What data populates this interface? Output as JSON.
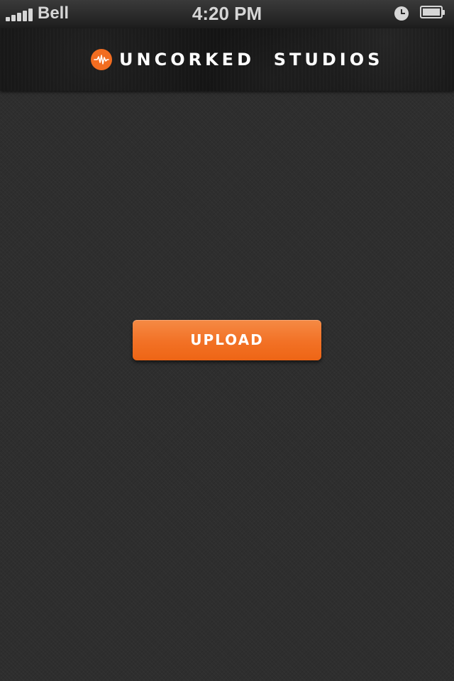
{
  "status_bar": {
    "carrier": "Bell",
    "time": "4:20 PM",
    "signal_bars": 5,
    "icons": [
      "signal-icon",
      "alarm-icon",
      "battery-icon"
    ]
  },
  "header": {
    "brand_name": "UNCORKED  STUDIOS",
    "logo_icon": "uncorked-logo-icon"
  },
  "main": {
    "upload_label": "UPLOAD"
  },
  "colors": {
    "accent": "#f26d21",
    "background": "#2e2e2e",
    "header_background": "#141414",
    "text_light": "#ffffff"
  }
}
